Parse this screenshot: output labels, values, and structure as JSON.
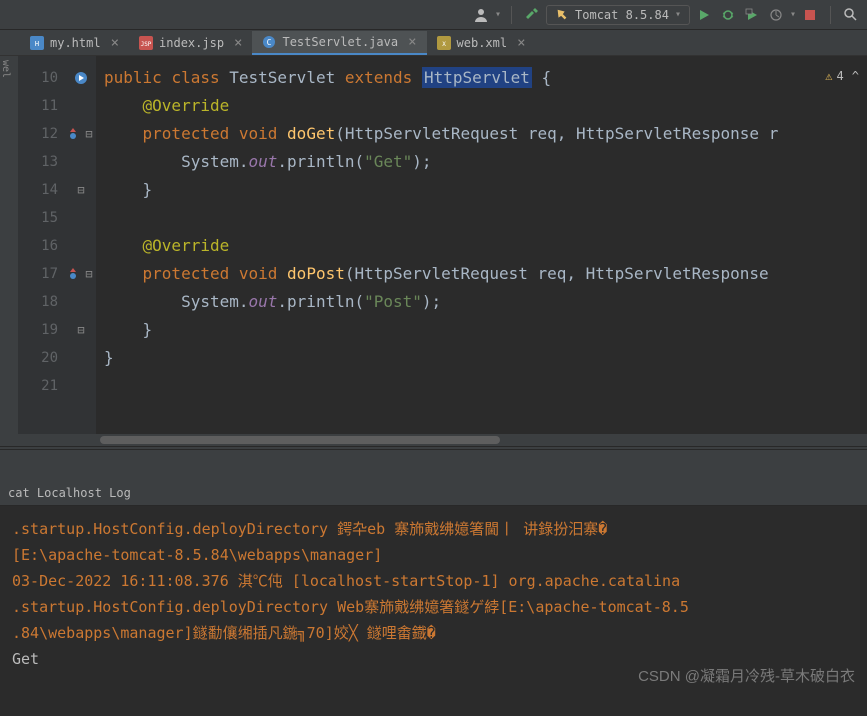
{
  "toolbar": {
    "run_config": "Tomcat 8.5.84"
  },
  "tabs": [
    {
      "label": "my.html",
      "active": false
    },
    {
      "label": "index.jsp",
      "active": false
    },
    {
      "label": "TestServlet.java",
      "active": true
    },
    {
      "label": "web.xml",
      "active": false
    }
  ],
  "warning_count": "4",
  "left_strip": "wel",
  "code": {
    "lines": [
      {
        "n": "10"
      },
      {
        "n": "11"
      },
      {
        "n": "12"
      },
      {
        "n": "13"
      },
      {
        "n": "14"
      },
      {
        "n": "15"
      },
      {
        "n": "16"
      },
      {
        "n": "17"
      },
      {
        "n": "18"
      },
      {
        "n": "19"
      },
      {
        "n": "20"
      },
      {
        "n": "21"
      }
    ],
    "l10": {
      "kw1": "public",
      "kw2": "class",
      "cls": "TestServlet",
      "kw3": "extends",
      "sup": "HttpServlet",
      "brace": " {"
    },
    "l11": {
      "anno": "@Override"
    },
    "l12": {
      "kw1": "protected",
      "kw2": "void",
      "m": "doGet",
      "sig": "(HttpServletRequest req, HttpServletResponse r"
    },
    "l13": {
      "pre": "System.",
      "field": "out",
      "call": ".println(",
      "str": "\"Get\"",
      "end": ");"
    },
    "l14": {
      "brace": "}"
    },
    "l16": {
      "anno": "@Override"
    },
    "l17": {
      "kw1": "protected",
      "kw2": "void",
      "m": "doPost",
      "sig": "(HttpServletRequest req, HttpServletResponse "
    },
    "l18": {
      "pre": "System.",
      "field": "out",
      "call": ".println(",
      "str": "\"Post\"",
      "end": ");"
    },
    "l19": {
      "brace": "}"
    },
    "l20": {
      "brace": "}"
    }
  },
  "console_tab": "cat Localhost Log",
  "console_lines": [
    ".startup.HostConfig.deployDirectory 鍔卆eb  寨斾戭绋嬑箸閫丨 讲錄扮汨寨�",
    "[E:\\apache-tomcat-8.5.84\\webapps\\manager]",
    "03-Dec-2022 16:11:08.376 淇℃伅 [localhost-startStop-1] org.apache.catalina",
    ".startup.HostConfig.deployDirectory Web寨斾戭绋嬑箸鐩ゲ綍[E:\\apache-tomcat-8.5",
    ".84\\webapps\\manager]鐩勫儴缃插凡鍦╗70]姣╳  鐩哩畬鐡�"
  ],
  "console_output": "Get",
  "watermark": "CSDN @凝霜月冷残-草木破白衣"
}
